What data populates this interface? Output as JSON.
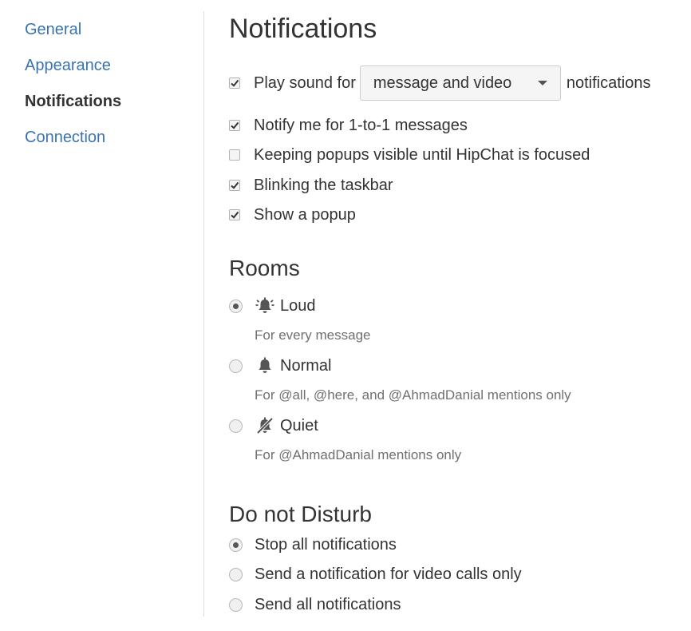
{
  "sidebar": {
    "items": [
      {
        "label": "General",
        "active": false
      },
      {
        "label": "Appearance",
        "active": false
      },
      {
        "label": "Notifications",
        "active": true
      },
      {
        "label": "Connection",
        "active": false
      }
    ]
  },
  "notifications": {
    "title": "Notifications",
    "play_sound": {
      "checked": true,
      "prefix": "Play sound for",
      "selected": "message and video",
      "suffix": "notifications"
    },
    "options": [
      {
        "label": "Notify me for 1-to-1 messages",
        "checked": true
      },
      {
        "label": "Keeping popups visible until HipChat is focused",
        "checked": false
      },
      {
        "label": "Blinking the taskbar",
        "checked": true
      },
      {
        "label": "Show a popup",
        "checked": true
      }
    ]
  },
  "rooms": {
    "title": "Rooms",
    "options": [
      {
        "label": "Loud",
        "description": "For every message",
        "selected": true,
        "icon": "bell-ringing-icon"
      },
      {
        "label": "Normal",
        "description": "For @all, @here, and @AhmadDanial mentions only",
        "selected": false,
        "icon": "bell-icon"
      },
      {
        "label": "Quiet",
        "description": "For @AhmadDanial mentions only",
        "selected": false,
        "icon": "bell-muted-icon"
      }
    ]
  },
  "dnd": {
    "title": "Do not Disturb",
    "options": [
      {
        "label": "Stop all notifications",
        "selected": true
      },
      {
        "label": "Send a notification for video calls only",
        "selected": false
      },
      {
        "label": "Send all notifications",
        "selected": false
      }
    ]
  },
  "colors": {
    "link": "#3b73af",
    "text": "#333333",
    "muted": "#707070"
  }
}
